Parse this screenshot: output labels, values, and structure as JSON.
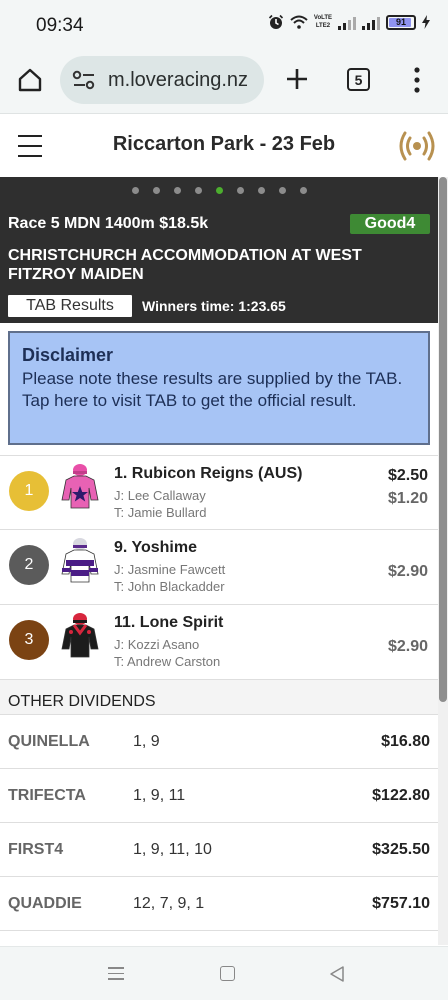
{
  "status_bar": {
    "time": "09:34",
    "battery": "91",
    "volte_top": "VoLTE",
    "volte_bottom": "LTE2"
  },
  "browser": {
    "url": "m.loveracing.nz",
    "tab_count": "5"
  },
  "header": {
    "title": "Riccarton Park - 23 Feb"
  },
  "race": {
    "carousel_dots": 9,
    "carousel_active_index": 4,
    "summary": "Race 5 MDN 1400m $18.5k",
    "going": "Good4",
    "name": "CHRISTCHURCH ACCOMMODATION AT WEST FITZROY MAIDEN",
    "tab_results_label": "TAB Results",
    "winners_time": "Winners time: 1:23.65"
  },
  "disclaimer": {
    "title": "Disclaimer",
    "text": "Please note these results are supplied by the TAB. Tap here to visit TAB to get the official result."
  },
  "runners": [
    {
      "position": "1",
      "name": "1. Rubicon Reigns (AUS)",
      "jockey": "J: Lee Callaway",
      "trainer": "T: Jamie Bullard",
      "win": "$2.50",
      "place": "$1.20",
      "circle_color": "#e7bf36"
    },
    {
      "position": "2",
      "name": "9. Yoshime",
      "jockey": "J: Jasmine Fawcett",
      "trainer": "T: John Blackadder",
      "place": "$2.90",
      "circle_color": "#5b5b5b"
    },
    {
      "position": "3",
      "name": "11. Lone Spirit",
      "jockey": "J: Kozzi Asano",
      "trainer": "T: Andrew Carston",
      "place": "$2.90",
      "circle_color": "#7b4313"
    }
  ],
  "other_dividends": {
    "heading": "OTHER DIVIDENDS",
    "rows": [
      {
        "type": "QUINELLA",
        "runners": "1, 9",
        "amount": "$16.80"
      },
      {
        "type": "TRIFECTA",
        "runners": "1, 9, 11",
        "amount": "$122.80"
      },
      {
        "type": "FIRST4",
        "runners": "1, 9, 11, 10",
        "amount": "$325.50"
      },
      {
        "type": "QUADDIE",
        "runners": "12, 7, 9, 1",
        "amount": "$757.10"
      }
    ]
  }
}
